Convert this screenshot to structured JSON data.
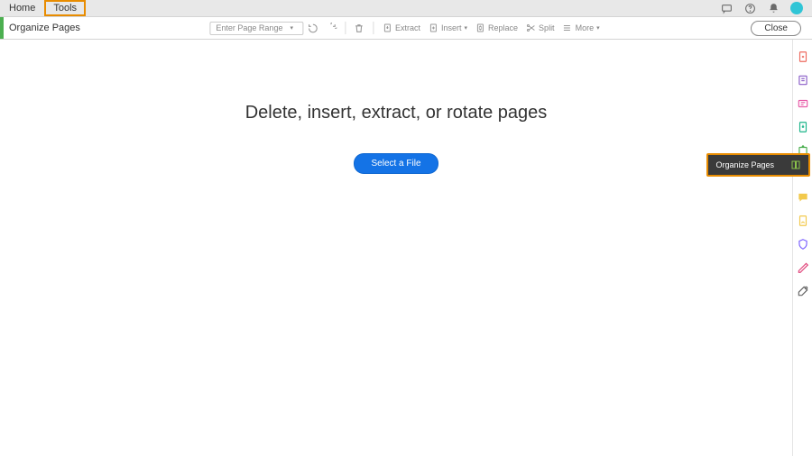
{
  "menubar": {
    "home": "Home",
    "tools": "Tools"
  },
  "toolbar": {
    "title": "Organize Pages",
    "page_range_placeholder": "Enter Page Range",
    "extract": "Extract",
    "insert": "Insert",
    "replace": "Replace",
    "split": "Split",
    "more": "More",
    "close": "Close"
  },
  "content": {
    "headline": "Delete, insert, extract, or rotate pages",
    "select_file": "Select a File"
  },
  "floating": {
    "organize_pages": "Organize Pages"
  },
  "rail": {
    "items": [
      {
        "name": "create-pdf-icon",
        "color": "#ed6a5e"
      },
      {
        "name": "edit-pdf-icon",
        "color": "#8a5cc7"
      },
      {
        "name": "export-pdf-icon",
        "color": "#e85ba8"
      },
      {
        "name": "combine-icon",
        "color": "#1cb58a"
      },
      {
        "name": "share-icon",
        "color": "#4caf50"
      },
      {
        "name": "organize-pages-icon",
        "color": "#8bc34a"
      },
      {
        "name": "comment-icon",
        "color": "#f2c94c"
      },
      {
        "name": "fill-sign-icon",
        "color": "#f2c94c"
      },
      {
        "name": "protect-icon",
        "color": "#7b61ff"
      },
      {
        "name": "redact-icon",
        "color": "#e0457b"
      },
      {
        "name": "more-tools-icon",
        "color": "#666"
      }
    ]
  }
}
